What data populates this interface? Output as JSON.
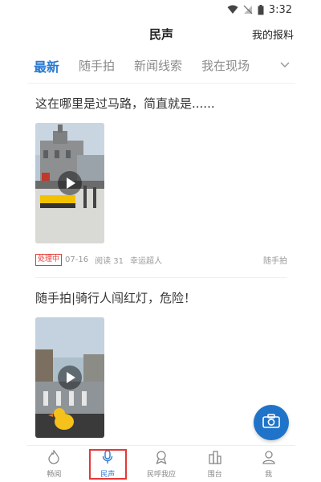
{
  "status_bar": {
    "time": "3:32"
  },
  "header": {
    "title": "民声",
    "my_report_label": "我的报料"
  },
  "tabs": [
    {
      "label": "最新",
      "active": true
    },
    {
      "label": "随手拍",
      "active": false
    },
    {
      "label": "新闻线索",
      "active": false
    },
    {
      "label": "我在现场",
      "active": false
    }
  ],
  "posts": [
    {
      "title": "这在哪里是过马路，简直就是......",
      "badge": "处理中",
      "date": "07-16",
      "reads": "阅读 31",
      "author": "幸运超人",
      "category": "随手拍"
    },
    {
      "title": "随手拍|骑行人闯红灯，危险！"
    }
  ],
  "bottom_nav": [
    {
      "label": "畅阅",
      "icon": "flame-icon",
      "active": false
    },
    {
      "label": "民声",
      "icon": "microphone-icon",
      "active": true
    },
    {
      "label": "民呼我应",
      "icon": "award-icon",
      "active": false
    },
    {
      "label": "围台",
      "icon": "building-icon",
      "active": false
    },
    {
      "label": "我",
      "icon": "user-icon",
      "active": false
    }
  ],
  "colors": {
    "accent": "#2a7ad2",
    "badge_red": "#e53935",
    "fab": "#1f74c9"
  }
}
